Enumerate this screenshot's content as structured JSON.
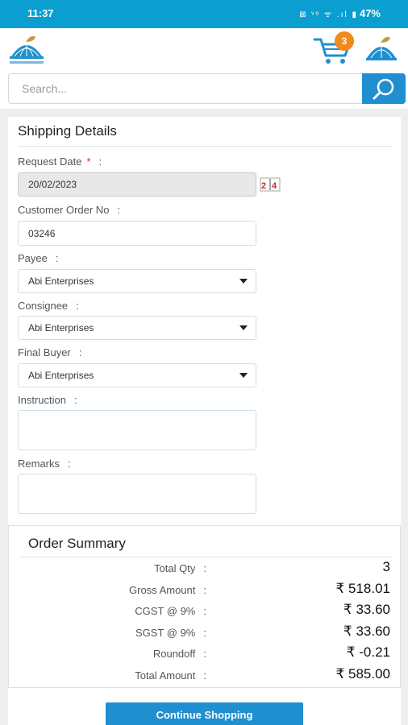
{
  "status_bar": {
    "time": "11:37",
    "icons": "⊠ ᵛᵒ ᯤ .ıl ▮",
    "battery": "47%"
  },
  "app_bar": {
    "cart_count": "3"
  },
  "search": {
    "placeholder": "Search..."
  },
  "shipping": {
    "title": "Shipping Details",
    "fields": {
      "request_date": {
        "label": "Request Date",
        "required_mark": "*",
        "value": "20/02/2023",
        "calendar_icon_text": "2 4"
      },
      "customer_order_no": {
        "label": "Customer Order No",
        "value": "03246"
      },
      "payee": {
        "label": "Payee",
        "selected": "Abi Enterprises"
      },
      "consignee": {
        "label": "Consignee",
        "selected": "Abi Enterprises"
      },
      "final_buyer": {
        "label": "Final Buyer",
        "selected": "Abi Enterprises"
      },
      "instruction": {
        "label": "Instruction",
        "value": ""
      },
      "remarks": {
        "label": "Remarks",
        "value": ""
      }
    },
    "colon": ":"
  },
  "order_summary": {
    "title": "Order Summary",
    "rows": [
      {
        "label": "Total Qty",
        "value": "3"
      },
      {
        "label": "Gross Amount",
        "value": "₹ 518.01"
      },
      {
        "label": "CGST @ 9%",
        "value": "₹ 33.60"
      },
      {
        "label": "SGST @ 9%",
        "value": "₹ 33.60"
      },
      {
        "label": "Roundoff",
        "value": "₹ -0.21"
      },
      {
        "label": "Total Amount",
        "value": "₹ 585.00"
      }
    ]
  },
  "actions": {
    "continue_label": "Continue Shopping"
  },
  "colors": {
    "primary": "#1f8fd0",
    "status_bar": "#0a9fd0",
    "badge": "#f08a1c",
    "required": "#e02020"
  }
}
